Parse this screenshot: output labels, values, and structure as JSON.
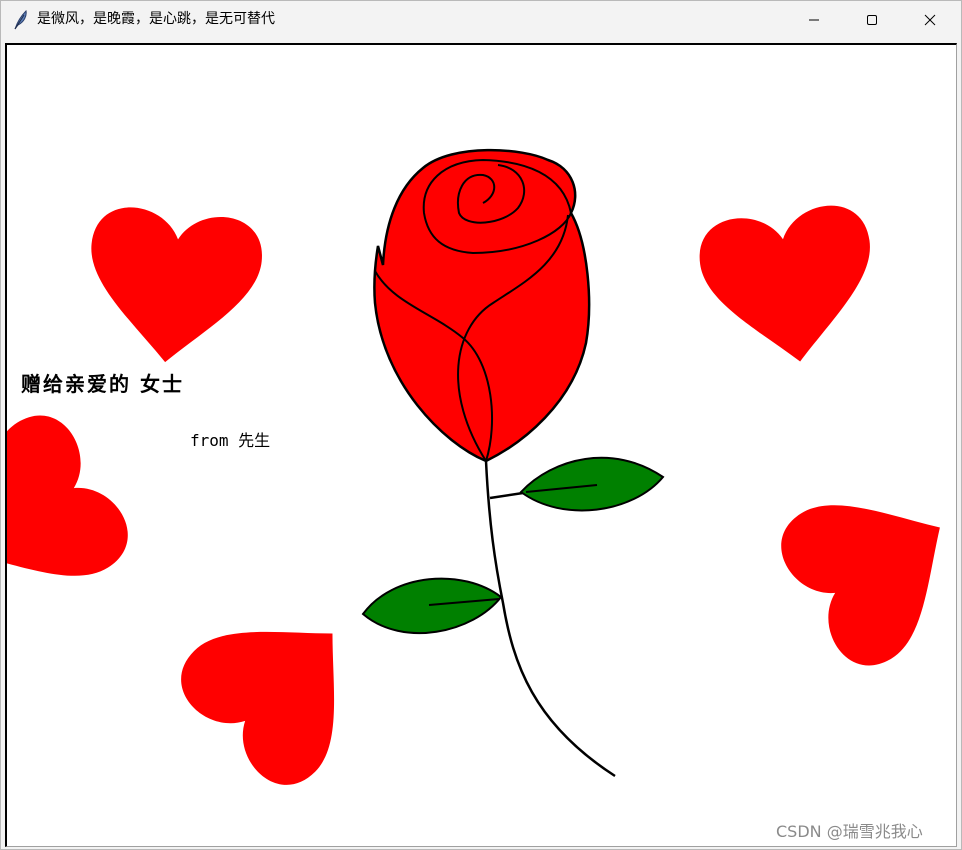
{
  "window": {
    "title": "是微风，是晚霞，是心跳，是无可替代",
    "app_icon": "feather-icon",
    "controls": {
      "minimize": "minimize-icon",
      "maximize": "maximize-icon",
      "close": "close-icon"
    }
  },
  "canvas": {
    "dedication": "赠给亲爱的 女士",
    "signature": "from 先生",
    "watermark": "CSDN @瑞雪兆我心"
  },
  "colors": {
    "heart": "#ff0000",
    "rose": "#ff0000",
    "leaf": "#008000",
    "outline": "#000000",
    "background": "#ffffff",
    "titlebar": "#f3f3f3"
  }
}
